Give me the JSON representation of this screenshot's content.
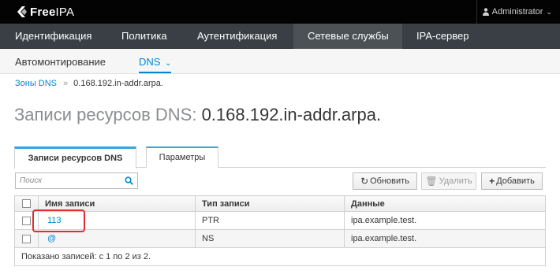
{
  "app": {
    "logo_text_bold": "Free",
    "logo_text": "IPA",
    "user": "Administrator",
    "colors": {
      "topbar": "#030303",
      "nav": "#393f44",
      "accent": "#0088ce",
      "highlight": "#e52b2b"
    }
  },
  "mainnav": {
    "items": [
      "Идентификация",
      "Политика",
      "Аутентификация",
      "Сетевые службы",
      "IPA-сервер"
    ],
    "active_index": 3
  },
  "subnav": {
    "items": [
      "Автомонтирование",
      "DNS"
    ],
    "active_index": 1
  },
  "breadcrumb": {
    "parent": "Зоны DNS",
    "separator": "»",
    "current": "0.168.192.in-addr.arpa."
  },
  "page": {
    "title_prefix": "Записи ресурсов DNS:",
    "title_name": "0.168.192.in-addr.arpa."
  },
  "tabs": {
    "items": [
      "Записи ресурсов DNS",
      "Параметры"
    ],
    "active_index": 0
  },
  "toolbar": {
    "search_placeholder": "Поиск",
    "refresh_label": "Обновить",
    "delete_label": "Удалить",
    "add_label": "Добавить"
  },
  "table": {
    "columns": [
      "Имя записи",
      "Тип записи",
      "Данные"
    ],
    "rows": [
      {
        "name": "113",
        "type": "PTR",
        "data": "ipa.example.test."
      },
      {
        "name": "@",
        "type": "NS",
        "data": "ipa.example.test."
      }
    ],
    "footer": "Показано записей: с 1 по 2 из 2."
  }
}
